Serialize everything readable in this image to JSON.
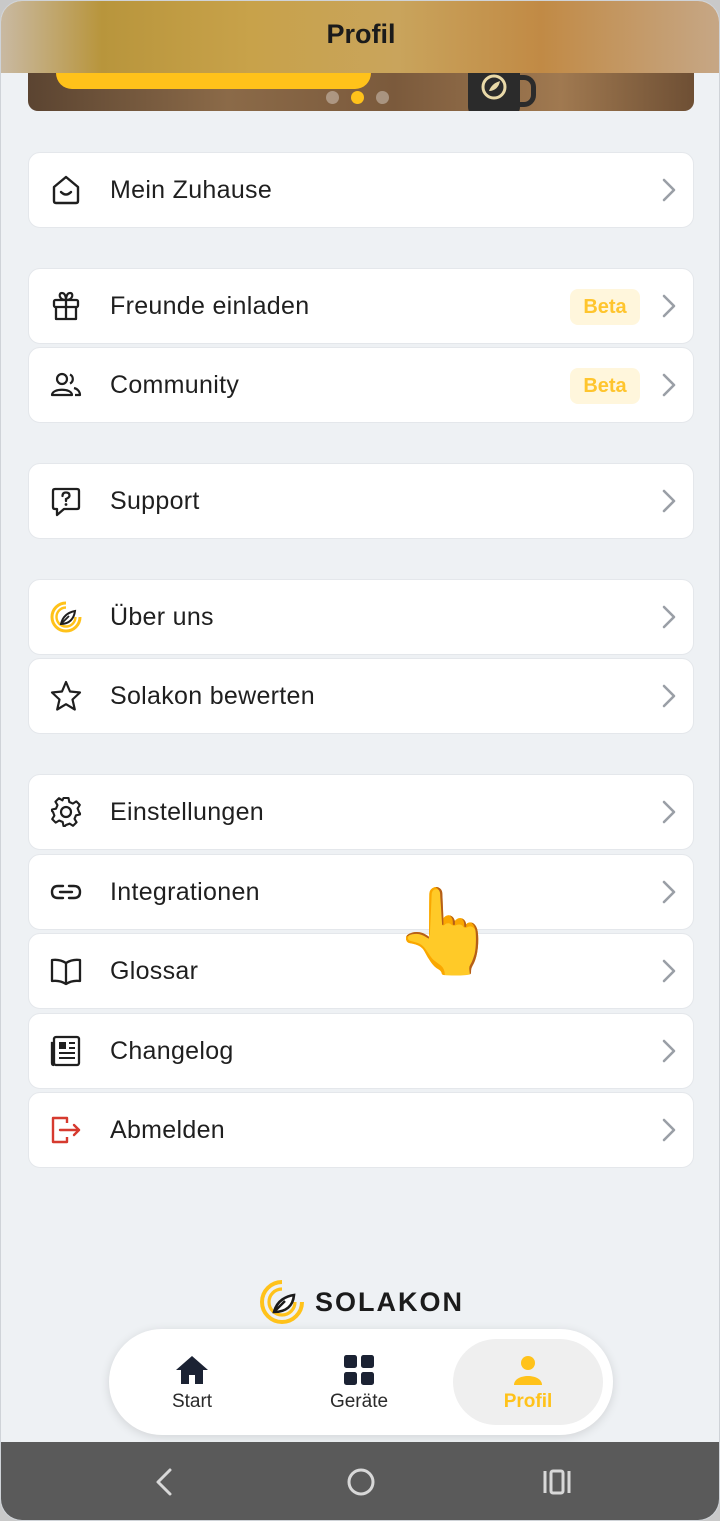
{
  "header": {
    "title": "Profil"
  },
  "carousel": {
    "dot_count": 3,
    "active_index": 1
  },
  "menu": [
    {
      "label": "Mein Zuhause",
      "icon": "home-icon"
    },
    {
      "label": "Freunde einladen",
      "icon": "gift-icon",
      "badge": "Beta"
    },
    {
      "label": "Community",
      "icon": "users-icon",
      "badge": "Beta"
    },
    {
      "label": "Support",
      "icon": "help-chat-icon"
    },
    {
      "label": "Über uns",
      "icon": "solakon-logo-icon"
    },
    {
      "label": "Solakon bewerten",
      "icon": "star-icon"
    },
    {
      "label": "Einstellungen",
      "icon": "gear-icon"
    },
    {
      "label": "Integrationen",
      "icon": "link-icon"
    },
    {
      "label": "Glossar",
      "icon": "book-icon"
    },
    {
      "label": "Changelog",
      "icon": "newspaper-icon"
    },
    {
      "label": "Abmelden",
      "icon": "logout-icon"
    }
  ],
  "brand": {
    "name": "SOLAKON"
  },
  "bottom_nav": [
    {
      "label": "Start",
      "icon": "house-icon"
    },
    {
      "label": "Geräte",
      "icon": "grid-icon"
    },
    {
      "label": "Profil",
      "icon": "person-icon",
      "active": true
    }
  ],
  "colors": {
    "accent": "#ffc21a",
    "logout": "#d63a2f",
    "background": "#eef1f4"
  }
}
